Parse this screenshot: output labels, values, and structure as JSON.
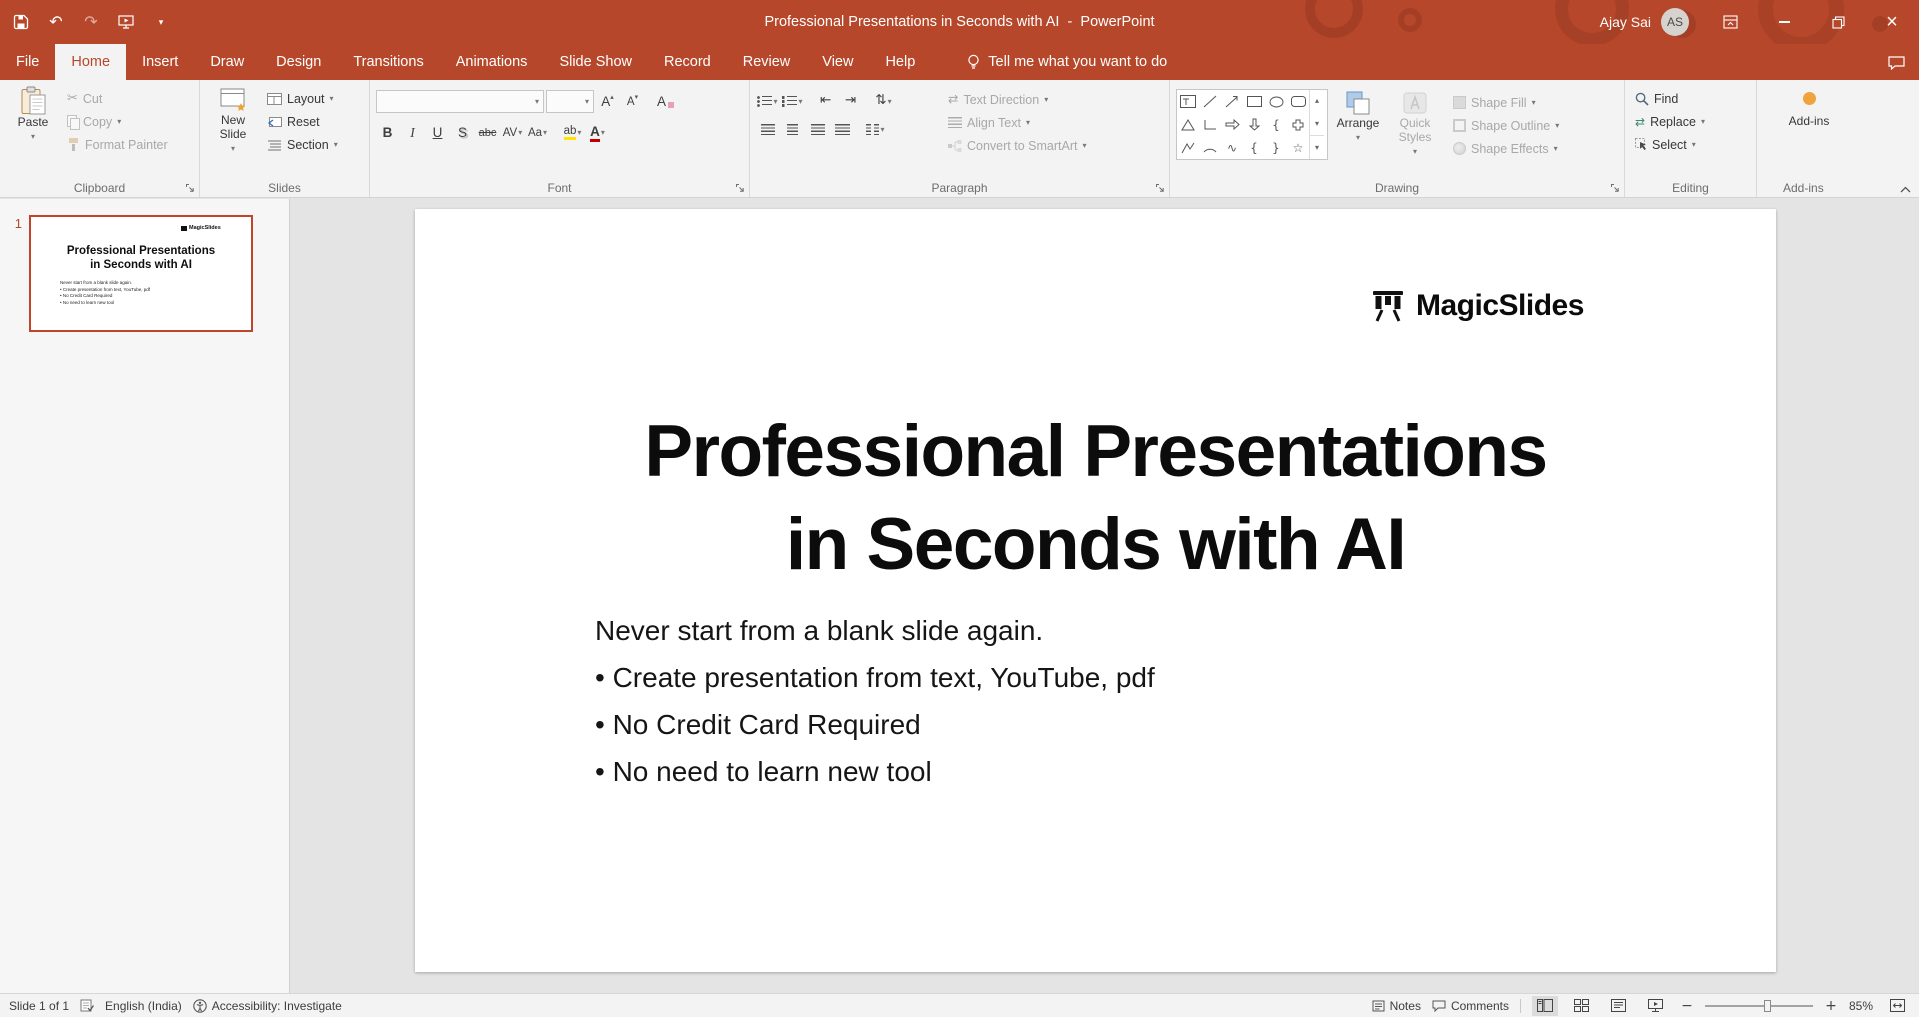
{
  "titlebar": {
    "title": "Professional Presentations in Seconds with AI  -  PowerPoint",
    "user": "Ajay Sai",
    "initials": "AS"
  },
  "tabs": [
    "File",
    "Home",
    "Insert",
    "Draw",
    "Design",
    "Transitions",
    "Animations",
    "Slide Show",
    "Record",
    "Review",
    "View",
    "Help"
  ],
  "tell_me": "Tell me what you want to do",
  "glyphs": {
    "undo": "↶",
    "redo": "↷",
    "chevron": "▾",
    "chevron_up": "▴",
    "cut": "✂",
    "close": "×",
    "bold": "B",
    "italic": "I",
    "underline": "U",
    "shadow": "S",
    "strike": "abc",
    "char_spacing": "AV",
    "change_case": "Aa",
    "grow_font": "A",
    "shrink_font": "A",
    "clear_format": "A",
    "highlight": "ab",
    "font_color": "A",
    "indent_dec": "⇤",
    "indent_inc": "⇥",
    "line_spacing": "⇅",
    "text_direction": "⇄",
    "replace_arrows": "⇄",
    "brace_l": "{",
    "brace_r": "}",
    "squiggle": "∿",
    "star": "☆",
    "zoom_out": "−",
    "zoom_in": "+"
  },
  "ribbon": {
    "clipboard": {
      "label": "Clipboard",
      "paste": "Paste",
      "cut": "Cut",
      "copy": "Copy",
      "format_painter": "Format Painter"
    },
    "slides": {
      "label": "Slides",
      "new_slide": "New Slide",
      "layout": "Layout",
      "reset": "Reset",
      "section": "Section"
    },
    "font": {
      "label": "Font"
    },
    "paragraph": {
      "label": "Paragraph",
      "text_direction": "Text Direction",
      "align_text": "Align Text",
      "convert_smartart": "Convert to SmartArt"
    },
    "drawing": {
      "label": "Drawing",
      "arrange": "Arrange",
      "quick_styles": "Quick Styles",
      "shape_fill": "Shape Fill",
      "shape_outline": "Shape Outline",
      "shape_effects": "Shape Effects"
    },
    "editing": {
      "label": "Editing",
      "find": "Find",
      "replace": "Replace",
      "select": "Select"
    },
    "addins": {
      "label": "Add-ins",
      "button": "Add-ins"
    }
  },
  "thumbnails": {
    "slide_number": "1"
  },
  "slide": {
    "logo": "MagicSlides",
    "title_line1": "Professional Presentations",
    "title_line2": "in Seconds with AI",
    "body": [
      "Never start from a blank slide again.",
      "• Create presentation from text, YouTube, pdf",
      "• No Credit Card Required",
      "• No need to learn new tool"
    ]
  },
  "statusbar": {
    "slide_indicator": "Slide 1 of 1",
    "language": "English (India)",
    "accessibility": "Accessibility: Investigate",
    "notes": "Notes",
    "comments": "Comments",
    "zoom": "85%"
  }
}
